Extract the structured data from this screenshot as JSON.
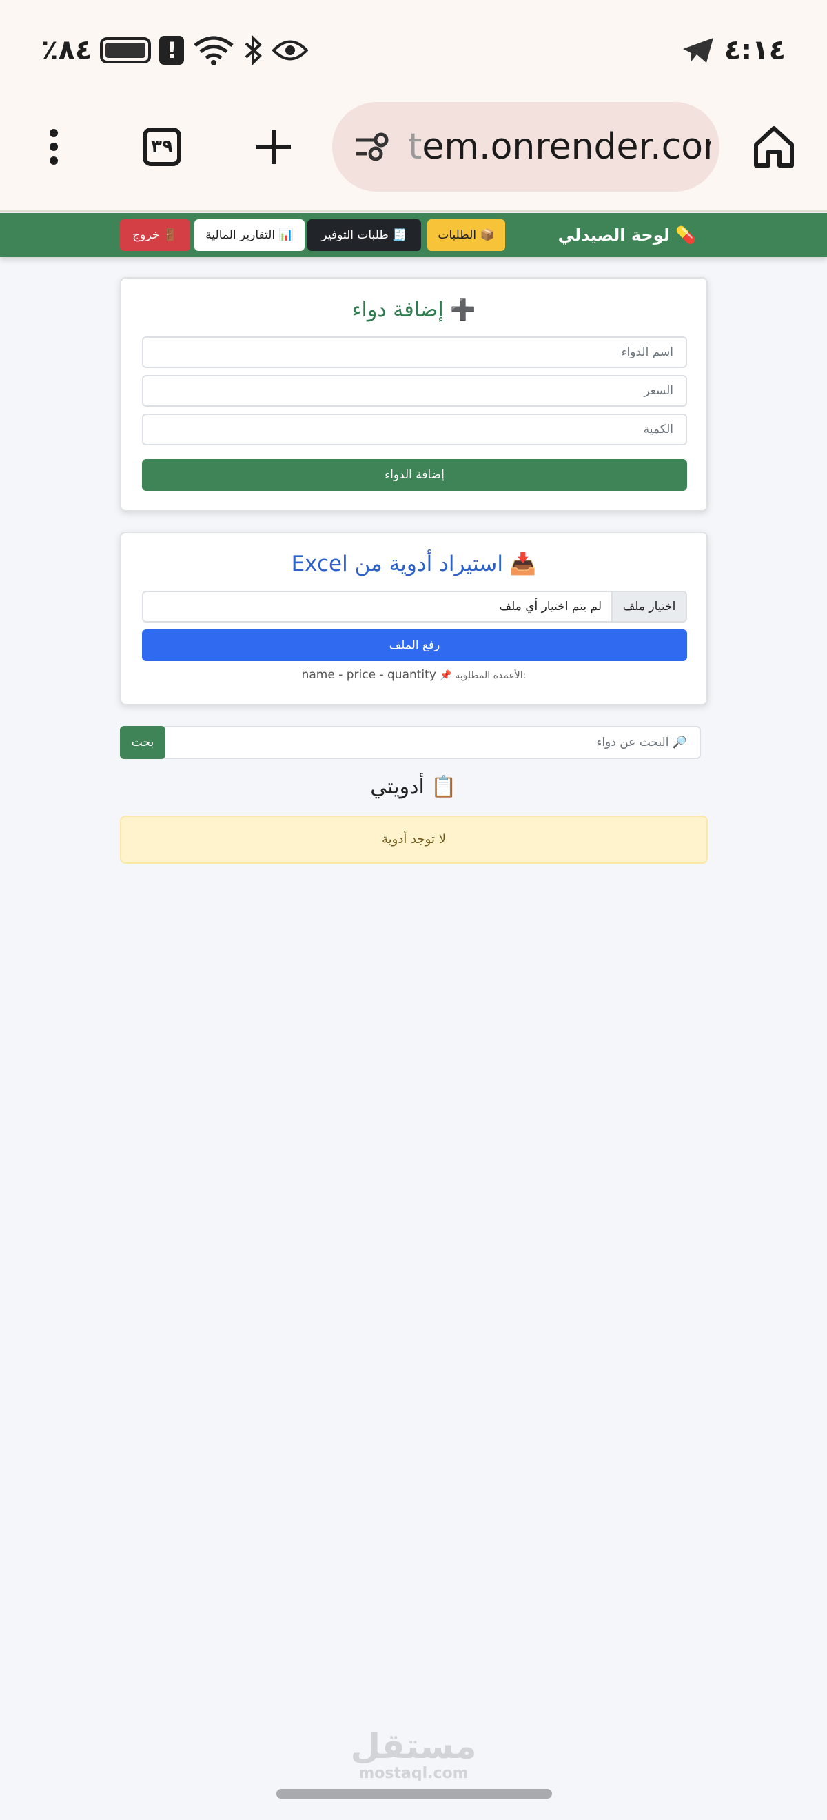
{
  "status_bar": {
    "time": "٤:١٤",
    "battery_text": "٨٤٪",
    "icons": [
      "telegram-icon",
      "battery-icon",
      "alert-icon",
      "wifi-icon",
      "bluetooth-icon",
      "eye-icon"
    ]
  },
  "browser": {
    "url_faded": "t",
    "url_main": "em.onrender.com",
    "tabs_count": "٣٩",
    "icons": [
      "home-icon",
      "site-settings-icon",
      "new-tab-icon",
      "tabs-icon",
      "menu-icon"
    ]
  },
  "navbar": {
    "brand": "💊 لوحة الصيدلي",
    "orders": "📦 الطلبات",
    "saving_requests": "🧾 طلبات التوفير",
    "financial_reports": "📊 التقارير المالية",
    "logout": "🚪 خروج",
    "colors": {
      "bg": "#3f8456",
      "orders": "#f7c338",
      "saving": "#212529",
      "logout": "#d33f45"
    }
  },
  "add_medicine": {
    "title": "➕ إضافة دواء",
    "name_placeholder": "اسم الدواء",
    "price_placeholder": "السعر",
    "quantity_placeholder": "الكمية",
    "submit": "إضافة الدواء"
  },
  "import": {
    "title": "📥 استيراد أدوية من Excel",
    "choose_file": "اختيار ملف",
    "no_file": "لم يتم اختيار أي ملف",
    "upload": "رفع الملف",
    "hint_label": "📌 الأعمدة المطلوبة:",
    "hint_columns": "name - price - quantity"
  },
  "search": {
    "placeholder": "🔎 البحث عن دواء",
    "button": "بحث"
  },
  "medicines": {
    "title": "📋 أدويتي",
    "empty": "لا توجد أدوية"
  },
  "watermark": {
    "ar": "مستقل",
    "en": "mostaql.com"
  }
}
